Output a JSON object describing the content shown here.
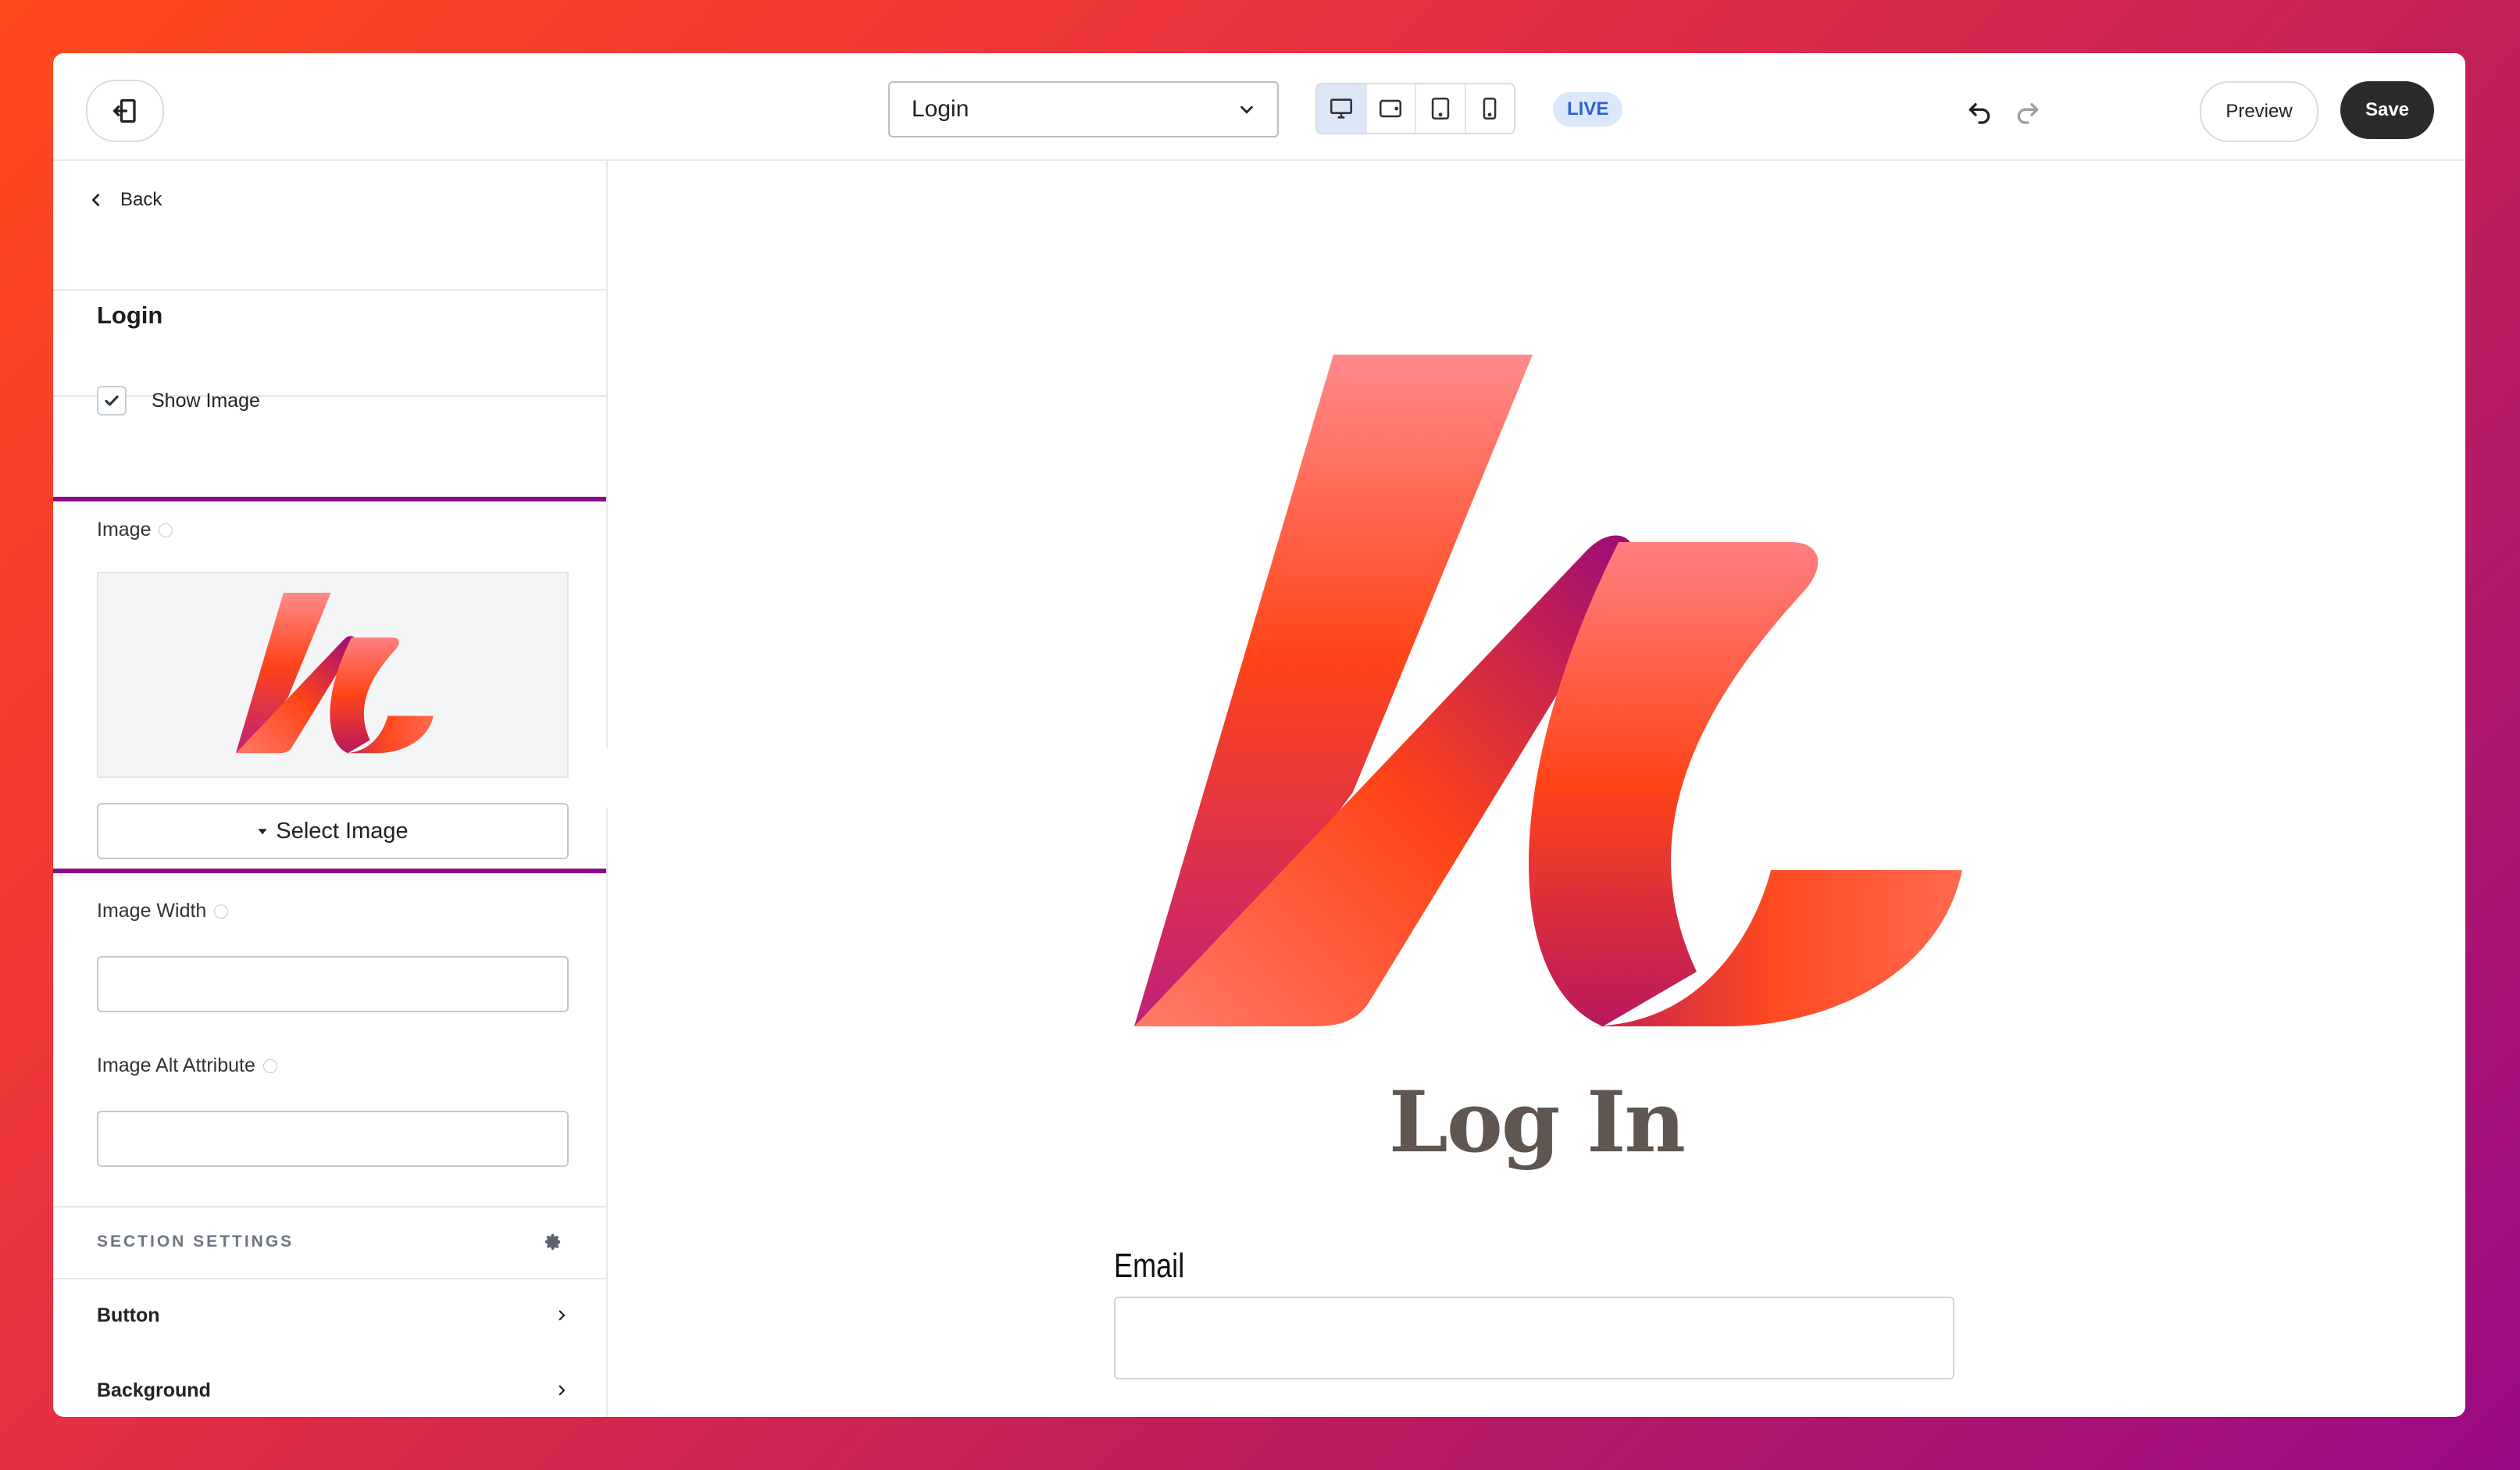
{
  "topbar": {
    "page_select_value": "Login",
    "live_badge": "LIVE",
    "preview_label": "Preview",
    "save_label": "Save"
  },
  "sidebar": {
    "back_label": "Back",
    "title": "Login",
    "show_image_label": "Show Image",
    "show_image_checked": true,
    "image_label": "Image",
    "select_image_label": "Select Image",
    "image_width_label": "Image Width",
    "image_width_value": "",
    "image_alt_label": "Image Alt Attribute",
    "image_alt_value": "",
    "section_settings_label": "SECTION SETTINGS",
    "accordion": [
      {
        "label": "Button"
      },
      {
        "label": "Background"
      }
    ]
  },
  "canvas": {
    "heading": "Log In",
    "email_label": "Email",
    "email_value": ""
  },
  "colors": {
    "highlight_border": "#8a0c86",
    "save_bg": "#2b2b2b",
    "live_bg": "#dbe8fb",
    "live_text": "#2c62c9",
    "heading_text": "#5f5651"
  }
}
